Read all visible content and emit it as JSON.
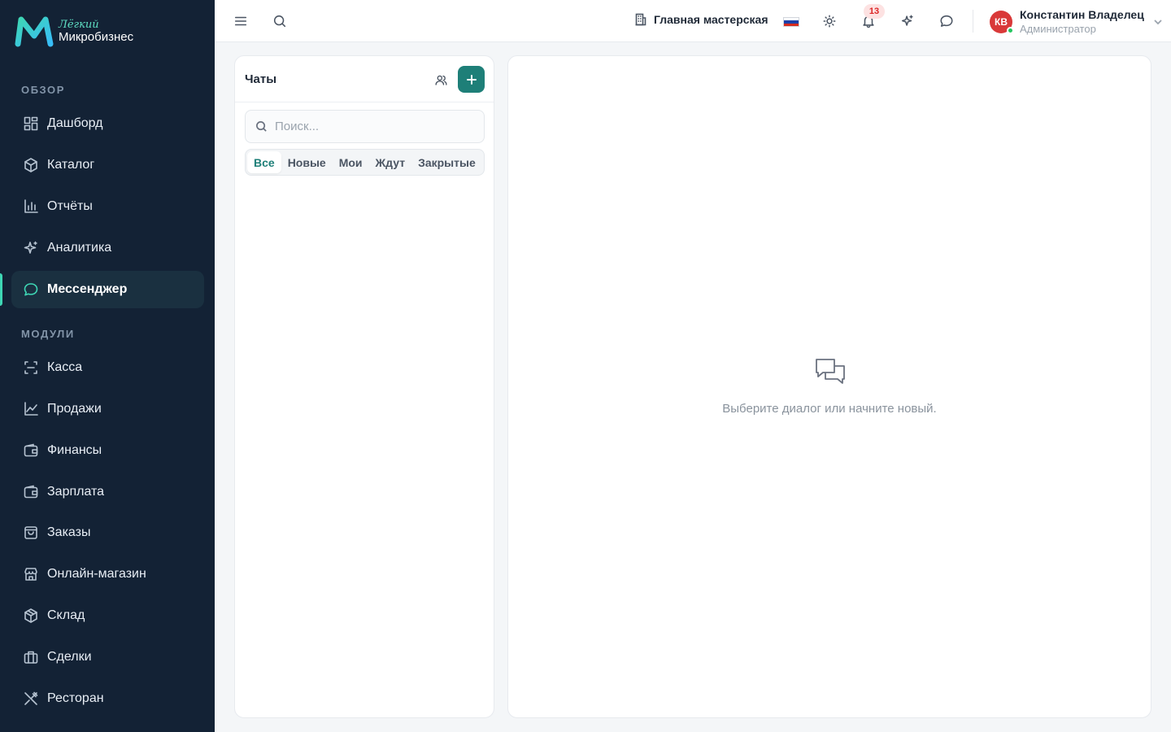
{
  "brand": {
    "top": "Лёгкий",
    "bottom": "Микробизнес",
    "accent": "#3ed6b4"
  },
  "sidebar": {
    "sections": [
      {
        "label": "ОБЗОР"
      },
      {
        "label": "МОДУЛИ"
      }
    ],
    "items": [
      {
        "label": "Дашборд",
        "icon": "dashboard-icon"
      },
      {
        "label": "Каталог",
        "icon": "catalog-icon"
      },
      {
        "label": "Отчёты",
        "icon": "reports-icon"
      },
      {
        "label": "Аналитика",
        "icon": "sparkle-icon"
      },
      {
        "label": "Мессенджер",
        "icon": "chat-bubble-icon",
        "active": true
      },
      {
        "label": "Касса",
        "icon": "scan-icon"
      },
      {
        "label": "Продажи",
        "icon": "chart-line-icon"
      },
      {
        "label": "Финансы",
        "icon": "wallet-icon"
      },
      {
        "label": "Зарплата",
        "icon": "wallet-icon"
      },
      {
        "label": "Заказы",
        "icon": "bag-icon"
      },
      {
        "label": "Онлайн-магазин",
        "icon": "store-icon"
      },
      {
        "label": "Склад",
        "icon": "box-icon"
      },
      {
        "label": "Сделки",
        "icon": "briefcase-icon"
      },
      {
        "label": "Ресторан",
        "icon": "utensils-icon"
      }
    ]
  },
  "topbar": {
    "workshop": "Главная мастерская",
    "notifications_count": "13",
    "user": {
      "initials": "КВ",
      "name": "Константин Владелец",
      "role": "Администратор"
    }
  },
  "chats": {
    "title": "Чаты",
    "search_placeholder": "Поиск...",
    "tabs": [
      "Все",
      "Новые",
      "Мои",
      "Ждут",
      "Закрытые"
    ],
    "active_tab": "Все"
  },
  "conversation": {
    "empty_text": "Выберите диалог или начните новый."
  },
  "colors": {
    "sidebar_bg": "#132235",
    "primary": "#1e7f78",
    "danger": "#dc2626"
  }
}
